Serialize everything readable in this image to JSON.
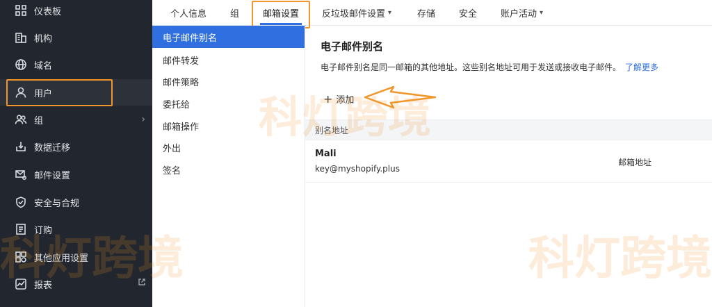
{
  "sidebar": {
    "items": [
      {
        "label": "仪表板",
        "icon": "dashboard-icon"
      },
      {
        "label": "机构",
        "icon": "building-icon"
      },
      {
        "label": "域名",
        "icon": "globe-icon"
      },
      {
        "label": "用户",
        "icon": "user-icon"
      },
      {
        "label": "组",
        "icon": "group-icon"
      },
      {
        "label": "数据迁移",
        "icon": "migration-icon"
      },
      {
        "label": "邮件设置",
        "icon": "mail-settings-icon"
      },
      {
        "label": "安全与合规",
        "icon": "shield-icon"
      },
      {
        "label": "订购",
        "icon": "subscription-icon"
      },
      {
        "label": "其他应用设置",
        "icon": "apps-icon"
      },
      {
        "label": "报表",
        "icon": "chart-icon"
      }
    ]
  },
  "tabs": [
    {
      "label": "个人信息"
    },
    {
      "label": "组"
    },
    {
      "label": "邮箱设置"
    },
    {
      "label": "反垃圾邮件设置"
    },
    {
      "label": "存储"
    },
    {
      "label": "安全"
    },
    {
      "label": "账户活动"
    }
  ],
  "subnav": [
    {
      "label": "电子邮件别名"
    },
    {
      "label": "邮件转发"
    },
    {
      "label": "邮件策略"
    },
    {
      "label": "委托给"
    },
    {
      "label": "邮箱操作"
    },
    {
      "label": "外出"
    },
    {
      "label": "签名"
    }
  ],
  "main": {
    "title": "电子邮件别名",
    "description": "电子邮件别名是同一邮箱的其他地址。这些别名地址可用于发送或接收电子邮件。",
    "learn_more": "了解更多",
    "add_label": "添加",
    "column_header": "别名地址",
    "rows": [
      {
        "name": "Mali",
        "email": "key@myshopify.plus",
        "type": "邮箱地址"
      }
    ]
  },
  "watermark": "科灯跨境",
  "colors": {
    "accent": "#2f6fe0",
    "highlight": "#f0962a",
    "sidebar_bg": "#22262e"
  }
}
